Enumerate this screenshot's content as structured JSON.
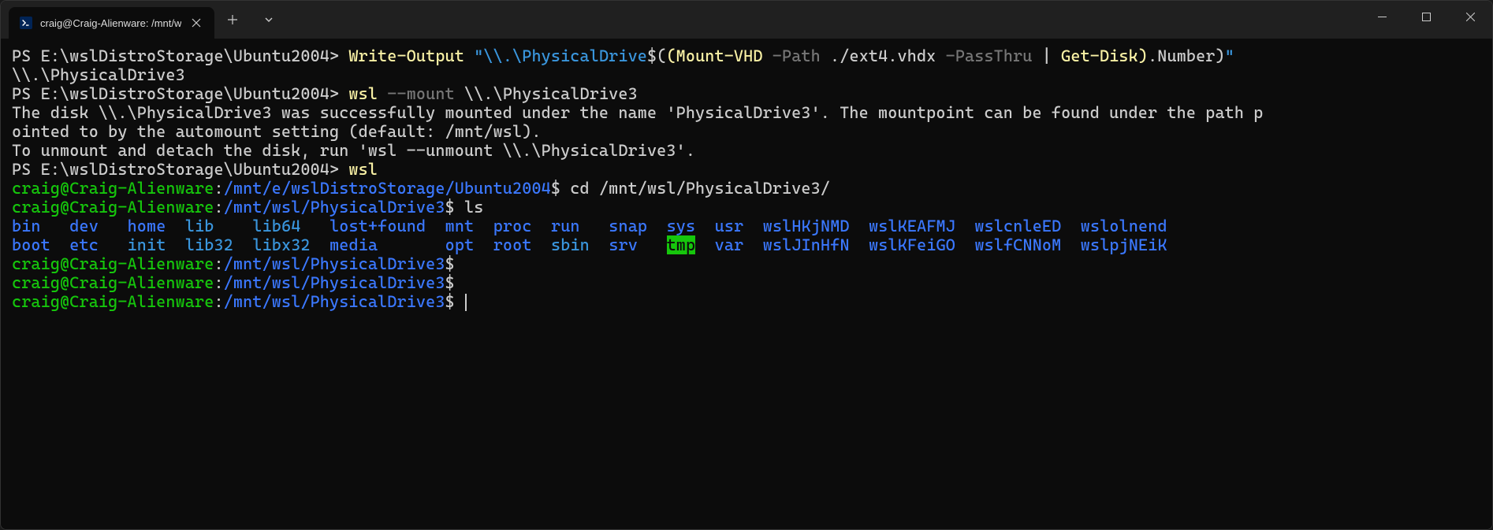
{
  "tab": {
    "title": "craig@Craig-Alienware: /mnt/w"
  },
  "ps_prompt": "PS E:\\wslDistroStorage\\Ubuntu2004> ",
  "line1": {
    "cmd": "Write-Output",
    "str1": "\"\\\\.\\PhysicalDrive",
    "dollar": "$(",
    "paren": "(",
    "mount": "Mount-VHD",
    "flag1": "-Path",
    "arg1": " ./ext4.vhdx ",
    "flag2": "-PassThru",
    "pipe": " | ",
    "getdisk": "Get-Disk",
    "close1": ")",
    "dot": ".",
    "number": "Number",
    "close2": ")",
    "strend": "\""
  },
  "line2": "\\\\.\\PhysicalDrive3",
  "line3": {
    "cmd": "wsl",
    "flag": "--mount",
    "arg": "\\\\.\\PhysicalDrive3"
  },
  "mount_msg1": "The disk \\\\.\\PhysicalDrive3 was successfully mounted under the name 'PhysicalDrive3'. The mountpoint can be found under the path p",
  "mount_msg2": "ointed to by the automount setting (default: /mnt/wsl).",
  "mount_msg3": "To unmount and detach the disk, run 'wsl --unmount \\\\.\\PhysicalDrive3'.",
  "line_wsl": {
    "cmd": "wsl"
  },
  "bash1": {
    "user": "craig@Craig-Alienware",
    "colon": ":",
    "path": "/mnt/e/wslDistroStorage/Ubuntu2004",
    "dollar": "$",
    "cmd": " cd /mnt/wsl/PhysicalDrive3/"
  },
  "bash2": {
    "user": "craig@Craig-Alienware",
    "colon": ":",
    "path": "/mnt/wsl/PhysicalDrive3",
    "dollar": "$",
    "cmd": " ls"
  },
  "ls_row1": {
    "c": [
      "bin",
      "dev",
      "home",
      "lib",
      "lib64",
      "lost+found",
      "mnt",
      "proc",
      "run",
      "snap",
      "sys",
      "usr",
      "wslHKjNMD",
      "wslKEAFMJ",
      "wslcnleED",
      "wslolnend"
    ]
  },
  "ls_row2": {
    "c": [
      "boot",
      "etc",
      "init",
      "lib32",
      "libx32",
      "media",
      "opt",
      "root",
      "sbin",
      "srv",
      "tmp",
      "var",
      "wslJInHfN",
      "wslKFeiGO",
      "wslfCNNoM",
      "wslpjNEiK"
    ]
  },
  "bash_empty": {
    "user": "craig@Craig-Alienware",
    "colon": ":",
    "path": "/mnt/wsl/PhysicalDrive3",
    "dollar": "$"
  }
}
